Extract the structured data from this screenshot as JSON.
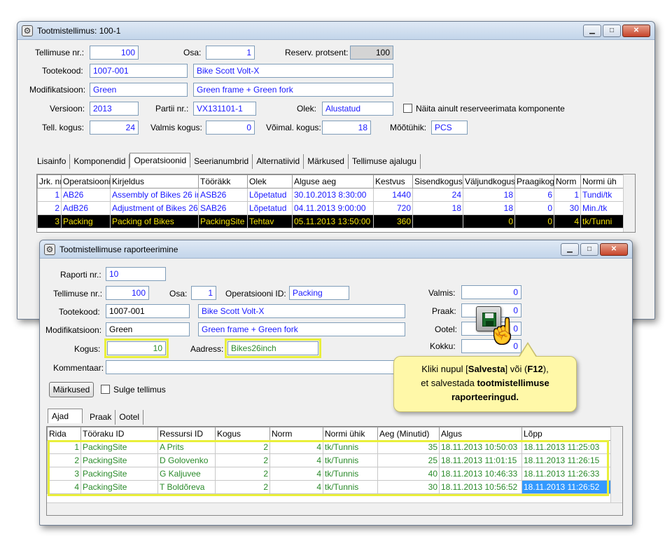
{
  "main_window": {
    "title": "Tootmistellimus: 100-1",
    "labels": {
      "order_no": "Tellimuse nr.:",
      "part": "Osa:",
      "reserve_pct": "Reserv. protsent:",
      "product_code": "Tootekood:",
      "modification": "Modifikatsioon:",
      "version": "Versioon:",
      "batch_no": "Partii nr.:",
      "state": "Olek:",
      "show_unreserved": "Näita ainult reserveerimata komponente",
      "order_qty": "Tell. kogus:",
      "done_qty": "Valmis kogus:",
      "possible_qty": "Võimal. kogus:",
      "unit": "Mõõtühik:"
    },
    "values": {
      "order_no": "100",
      "part": "1",
      "reserve_pct": "100",
      "product_code": "1007-001",
      "product_name": "Bike Scott Volt-X",
      "modification": "Green",
      "modification_desc": "Green frame + Green fork",
      "version": "2013",
      "batch_no": "VX131101-1",
      "state": "Alustatud",
      "order_qty": "24",
      "done_qty": "0",
      "possible_qty": "18",
      "unit": "PCS"
    },
    "tabs": [
      "Lisainfo",
      "Komponendid",
      "Operatsioonid",
      "Seerianumbrid",
      "Alternatiivid",
      "Märkused",
      "Tellimuse ajalugu"
    ],
    "active_tab": "Operatsioonid",
    "ops_columns": [
      "Jrk. nr",
      "Operatsiooni",
      "Kirjeldus",
      "Tööräkk",
      "Olek",
      "Alguse aeg",
      "Kestvus",
      "Sisendkogus",
      "Väljundkogus",
      "Praagikog",
      "Norm",
      "Normi üh"
    ],
    "ops_rows": [
      [
        "1",
        "AB26",
        "Assembly of Bikes 26 in",
        "ASB26",
        "Lõpetatud",
        "30.10.2013 8:30:00",
        "1440",
        "24",
        "18",
        "6",
        "1",
        "Tundi/tk"
      ],
      [
        "2",
        "AdB26",
        "Adjustment of Bikes 26",
        "SAB26",
        "Lõpetatud",
        "04.11.2013 9:00:00",
        "720",
        "18",
        "18",
        "0",
        "30",
        "Min./tk"
      ],
      [
        "3",
        "Packing",
        "Packing of Bikes",
        "PackingSite",
        "Tehtav",
        "05.11.2013 13:50:00",
        "360",
        "",
        "0",
        "0",
        "4",
        "tk/Tunni"
      ]
    ]
  },
  "report_window": {
    "title": "Tootmistellimuse raporteerimine",
    "labels": {
      "report_no": "Raporti nr.:",
      "order_no": "Tellimuse nr.:",
      "part": "Osa:",
      "operation_id": "Operatsiooni ID:",
      "product_code": "Tootekood:",
      "modification": "Modifikatsioon:",
      "quantity": "Kogus:",
      "address": "Aadress:",
      "comment": "Kommentaar:",
      "done": "Valmis:",
      "scrap": "Praak:",
      "waiting": "Ootel:",
      "total": "Kokku:",
      "close_order": "Sulge tellimus"
    },
    "values": {
      "report_no": "10",
      "order_no": "100",
      "part": "1",
      "operation_id": "Packing",
      "product_code": "1007-001",
      "product_name": "Bike Scott Volt-X",
      "modification": "Green",
      "modification_desc": "Green frame + Green fork",
      "quantity": "10",
      "address": "Bikes26inch",
      "comment": "",
      "done": "0",
      "scrap": "0",
      "waiting": "0",
      "total": "0"
    },
    "notes_button": "Märkused",
    "tabs": [
      "Ajad",
      "Praak",
      "Ootel"
    ],
    "time_columns": [
      "Rida",
      "Tööraku ID",
      "Ressursi ID",
      "Kogus",
      "Norm",
      "Normi ühik",
      "Aeg (Minutid)",
      "Algus",
      "Lõpp"
    ],
    "time_rows": [
      [
        "1",
        "PackingSite",
        "A Prits",
        "2",
        "4",
        "tk/Tunnis",
        "35",
        "18.11.2013 10:50:03",
        "18.11.2013 11:25:03"
      ],
      [
        "2",
        "PackingSite",
        "D Golovenko",
        "2",
        "4",
        "tk/Tunnis",
        "25",
        "18.11.2013 11:01:15",
        "18.11.2013 11:26:15"
      ],
      [
        "3",
        "PackingSite",
        "G Kaljuvee",
        "2",
        "4",
        "tk/Tunnis",
        "40",
        "18.11.2013 10:46:33",
        "18.11.2013 11:26:33"
      ],
      [
        "4",
        "PackingSite",
        "T Boldõreva",
        "2",
        "4",
        "tk/Tunnis",
        "30",
        "18.11.2013 10:56:52",
        "18.11.2013 11:26:52"
      ]
    ]
  },
  "callout": {
    "line1_pre": "Kliki nupul [",
    "line1_b1": "Salvesta",
    "line1_mid": "] või (",
    "line1_b2": "F12",
    "line1_post": "),",
    "line2_pre": "et salvestada ",
    "line2_b": "tootmistellimuse",
    "line3_b": "raporteeringud."
  },
  "icons": {
    "title_icon": "gear-icon",
    "save_icon": "floppy-disk-icon",
    "cursor": "hand-pointer-icon"
  }
}
